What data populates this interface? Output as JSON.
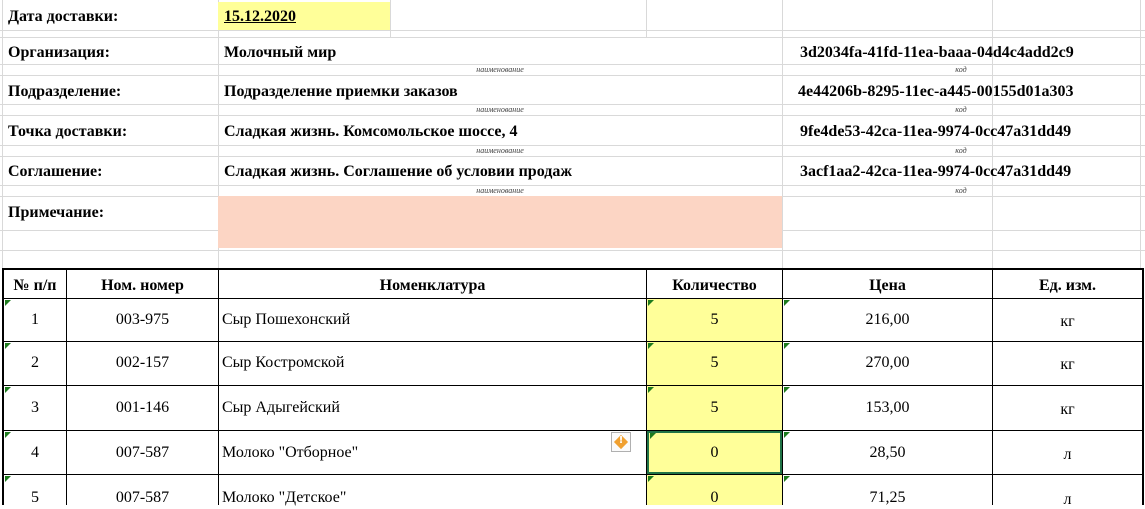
{
  "header": {
    "delivery_date_label": "Дата доставки:",
    "delivery_date_value": "15.12.2020",
    "fields": [
      {
        "label": "Организация:",
        "name": "Молочный мир",
        "code": "3d2034fa-41fd-11ea-baaa-04d4c4add2c9"
      },
      {
        "label": "Подразделение:",
        "name": "Подразделение приемки заказов",
        "code": "4e44206b-8295-11ec-a445-00155d01a303"
      },
      {
        "label": "Точка доставки:",
        "name": "Сладкая жизнь. Комсомольское шоссе, 4",
        "code": "9fe4de53-42ca-11ea-9974-0cc47a31dd49"
      },
      {
        "label": "Соглашение:",
        "name": "Сладкая жизнь. Соглашение об условии продаж",
        "code": "3acf1aa2-42ca-11ea-9974-0cc47a31dd49"
      }
    ],
    "name_caption": "наименование",
    "code_caption": "код",
    "note_label": "Примечание:"
  },
  "table": {
    "columns": [
      "№ п/п",
      "Ном. номер",
      "Номенклатура",
      "Количество",
      "Цена",
      "Ед. изм."
    ],
    "rows": [
      {
        "n": "1",
        "code": "003-975",
        "name": "Сыр Пошехонский",
        "qty": "5",
        "price": "216,00",
        "unit": "кг"
      },
      {
        "n": "2",
        "code": "002-157",
        "name": "Сыр Костромской",
        "qty": "5",
        "price": "270,00",
        "unit": "кг"
      },
      {
        "n": "3",
        "code": "001-146",
        "name": "Сыр Адыгейский",
        "qty": "5",
        "price": "153,00",
        "unit": "кг"
      },
      {
        "n": "4",
        "code": "007-587",
        "name": "Молоко \"Отборное\"",
        "qty": "0",
        "price": "28,50",
        "unit": "л"
      },
      {
        "n": "5",
        "code": "007-587",
        "name": "Молоко \"Детское\"",
        "qty": "0",
        "price": "71,25",
        "unit": "л"
      }
    ]
  },
  "icons": {
    "warning": "error-check-warning-icon",
    "warning_glyph": "!"
  }
}
